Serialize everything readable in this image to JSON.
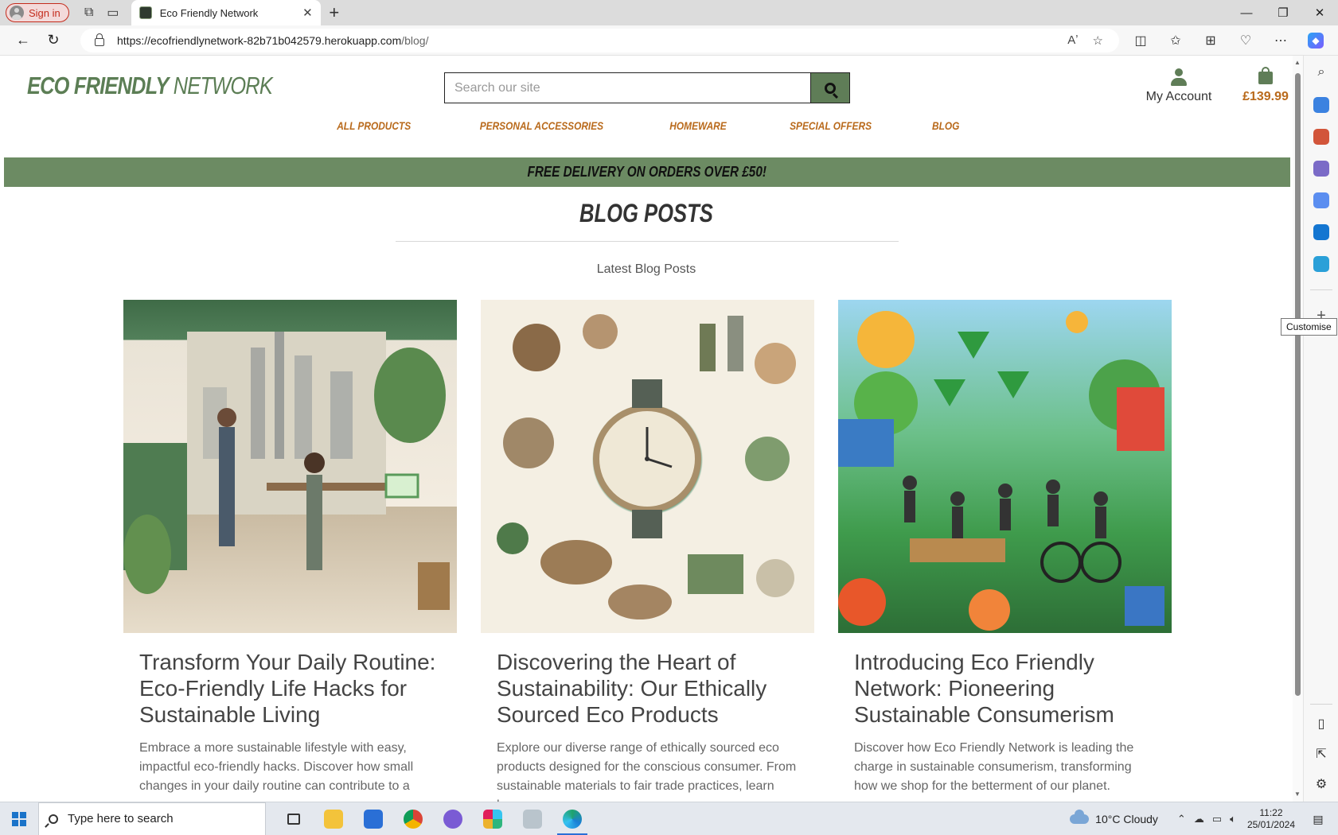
{
  "browser": {
    "signin_label": "Sign in",
    "tab_title": "Eco Friendly Network",
    "url_host": "https://ecofriendlynetwork-82b71b042579.herokuapp.com",
    "url_path": "/blog/",
    "sidebar_tooltip": "Customise"
  },
  "site": {
    "logo_bold": "ECO FRIENDLY",
    "logo_light": " NETWORK",
    "search_placeholder": "Search our site",
    "account_label": "My Account",
    "basket_total": "£139.99",
    "nav": [
      "ALL PRODUCTS",
      "PERSONAL ACCESSORIES",
      "HOMEWARE",
      "SPECIAL OFFERS",
      "BLOG"
    ],
    "banner": "FREE DELIVERY ON ORDERS OVER £50!"
  },
  "blog": {
    "heading": "BLOG POSTS",
    "subheading": "Latest Blog Posts",
    "posts": [
      {
        "title": "Transform Your Daily Routine: Eco-Friendly Life Hacks for Sustainable Living",
        "excerpt": "Embrace a more sustainable lifestyle with easy, impactful eco-friendly hacks. Discover how small changes in your daily routine can contribute to a"
      },
      {
        "title": "Discovering the Heart of Sustainability: Our Ethically Sourced Eco Products",
        "excerpt": "Explore our diverse range of ethically sourced eco products designed for the conscious consumer. From sustainable materials to fair trade practices, learn how"
      },
      {
        "title": "Introducing Eco Friendly Network: Pioneering Sustainable Consumerism",
        "excerpt": "Discover how Eco Friendly Network is leading the charge in sustainable consumerism, transforming how we shop for the betterment of our planet."
      }
    ]
  },
  "taskbar": {
    "search_placeholder": "Type here to search",
    "weather": "10°C  Cloudy",
    "time": "11:22",
    "date": "25/01/2024"
  }
}
